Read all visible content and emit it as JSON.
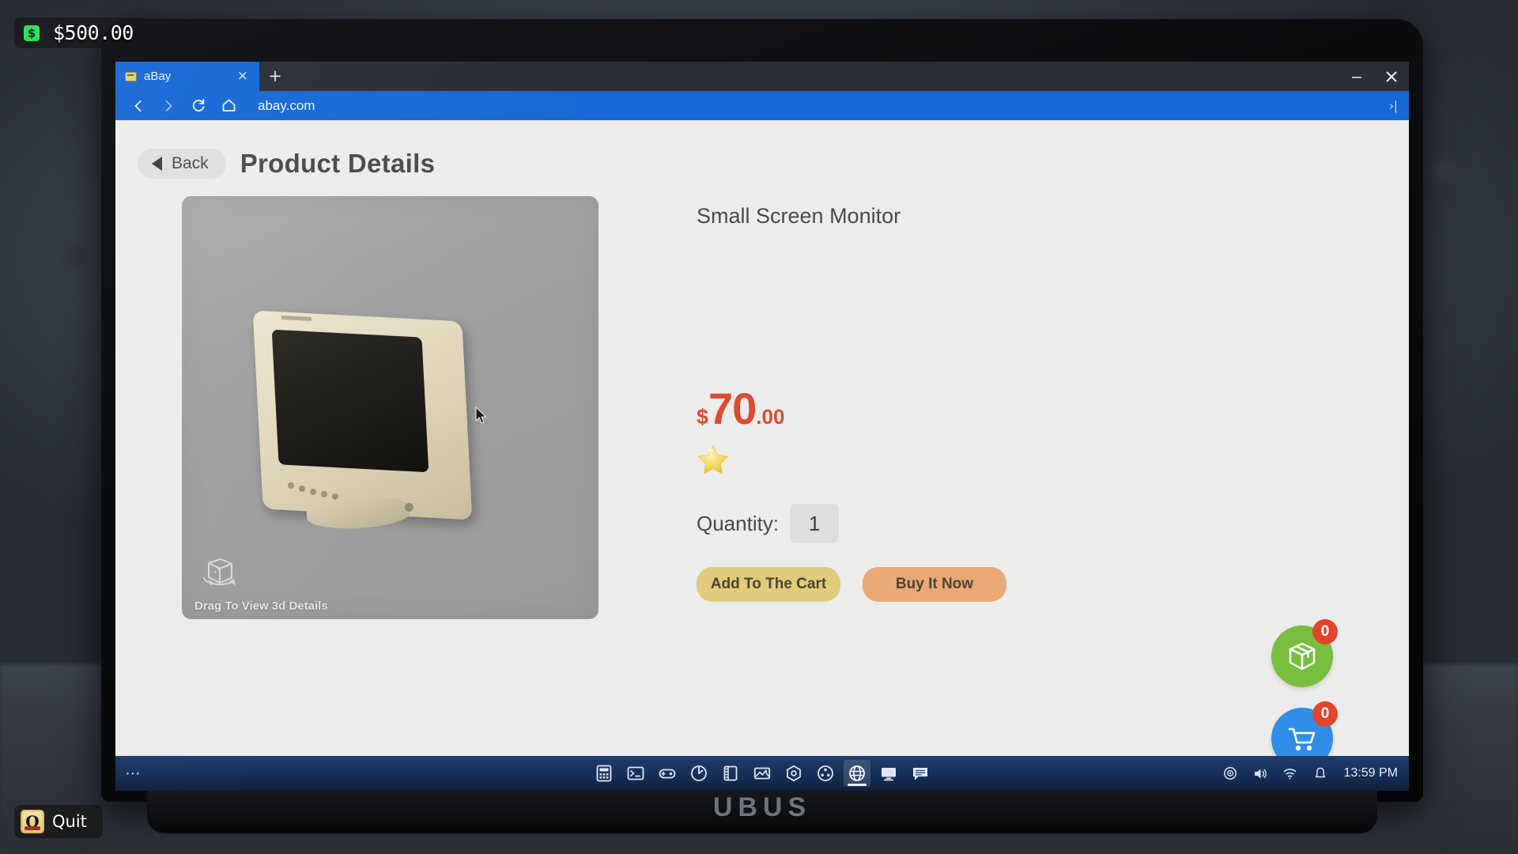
{
  "hud": {
    "money": "$500.00",
    "money_icon": "dollar-bill-icon",
    "quit_label": "Quit",
    "quit_key": "Q"
  },
  "laptop": {
    "brand": "UBUS"
  },
  "browser": {
    "tab": {
      "title": "aBay",
      "favicon": "page-favicon",
      "close_glyph": "×"
    },
    "new_tab_glyph": "+",
    "window_controls": {
      "minimize": "minimize-icon",
      "close": "close-icon"
    },
    "nav": {
      "back_icon": "chevron-left-icon",
      "forward_icon": "chevron-right-icon",
      "reload_icon": "reload-icon",
      "home_icon": "home-icon",
      "url": "abay.com",
      "expand_glyph": "›|"
    }
  },
  "page": {
    "back_label": "Back",
    "title": "Product Details",
    "product": {
      "name": "Small Screen Monitor",
      "price_currency": "$",
      "price_whole": "70",
      "price_cents": ".00",
      "rating_stars": 1,
      "quantity_label": "Quantity:",
      "quantity_value": "1",
      "add_to_cart_label": "Add To The Cart",
      "buy_now_label": "Buy It Now",
      "image_hint": "Drag To View 3d Details",
      "image_hint_icon": "rotate-cube-icon"
    },
    "floating": {
      "package_count": "0",
      "cart_count": "0"
    }
  },
  "taskbar": {
    "start_glyph": "⋯",
    "apps": [
      {
        "name": "calculator-icon"
      },
      {
        "name": "terminal-icon"
      },
      {
        "name": "gamepad-icon"
      },
      {
        "name": "power-meter-icon"
      },
      {
        "name": "notebook-icon"
      },
      {
        "name": "photo-editor-icon"
      },
      {
        "name": "settings-hex-icon"
      },
      {
        "name": "film-reel-icon"
      },
      {
        "name": "globe-browser-icon"
      },
      {
        "name": "monitor-icon"
      },
      {
        "name": "messages-icon"
      }
    ],
    "tray": [
      {
        "name": "disc-icon"
      },
      {
        "name": "volume-icon"
      },
      {
        "name": "wifi-icon"
      },
      {
        "name": "bell-icon"
      }
    ],
    "clock": "13:59 PM"
  },
  "colors": {
    "browser_blue": "#1668d6",
    "page_bg": "#ececeb",
    "price_red": "#dd4b30",
    "add_cart_yellow": "#e1cb7d",
    "buy_now_orange": "#eaa877",
    "package_green": "#78bf3f",
    "cart_blue": "#2f8fe8",
    "badge_red": "#e0452a"
  }
}
